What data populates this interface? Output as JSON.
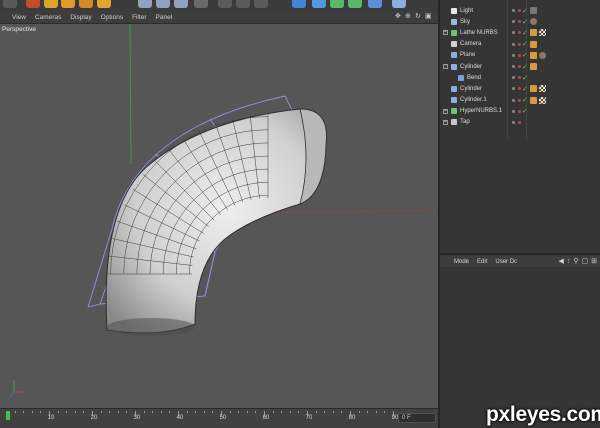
{
  "viewport": {
    "menu": [
      "View",
      "Cameras",
      "Display",
      "Options",
      "Filter",
      "Panel"
    ],
    "label": "Perspective"
  },
  "toolbar": {
    "icons": [
      {
        "name": "undo-icon",
        "color": "#5a5a5a"
      },
      {
        "name": "live-selection-icon",
        "color": "#c24a2d"
      },
      {
        "name": "move-icon",
        "color": "#e0a22a"
      },
      {
        "name": "scale-icon",
        "color": "#e09a2a"
      },
      {
        "name": "rotate-icon",
        "color": "#d48a22"
      },
      {
        "name": "last-tool-icon",
        "color": "#e2a530"
      },
      {
        "name": "x-axis-icon",
        "color": "#8fa2c0"
      },
      {
        "name": "y-axis-icon",
        "color": "#8fa2c0"
      },
      {
        "name": "z-axis-icon",
        "color": "#8fa2c0"
      },
      {
        "name": "coordinate-system-icon",
        "color": "#6a6a6a"
      },
      {
        "name": "render-view-icon",
        "color": "#5a5a5a"
      },
      {
        "name": "render-picture-viewer-icon",
        "color": "#5a5a5a"
      },
      {
        "name": "render-settings-icon",
        "color": "#5a5a5a"
      },
      {
        "name": "cube-icon",
        "color": "#3f86d4"
      },
      {
        "name": "pen-icon",
        "color": "#4f9bd8"
      },
      {
        "name": "subdivision-icon",
        "color": "#58b86a"
      },
      {
        "name": "array-icon",
        "color": "#5ab66c"
      },
      {
        "name": "deformer-icon",
        "color": "#5b8fd8"
      },
      {
        "name": "scene-icon",
        "color": "#8ab0e0"
      }
    ]
  },
  "objects": [
    {
      "name": "Light",
      "icon": "light-icon",
      "icon_color": "#e8e8e8",
      "indent": 0,
      "expand": "",
      "check": "✓",
      "tags": [
        "sky"
      ]
    },
    {
      "name": "Sky",
      "icon": "sky-icon",
      "icon_color": "#9fb9d8",
      "indent": 0,
      "expand": "",
      "check": "✓",
      "tags": [
        "globe"
      ]
    },
    {
      "name": "Lathe NURBS",
      "icon": "lathe-nurbs-icon",
      "icon_color": "#6fc26f",
      "indent": 0,
      "expand": "+",
      "check": "✓",
      "tags": [
        "orange",
        "checker"
      ]
    },
    {
      "name": "Camera",
      "icon": "camera-icon",
      "icon_color": "#d0d0d0",
      "indent": 0,
      "expand": "",
      "check": "✓",
      "tags": [
        "orange"
      ]
    },
    {
      "name": "Plane",
      "icon": "plane-icon",
      "icon_color": "#8ab0e0",
      "indent": 0,
      "expand": "",
      "check": "✓",
      "tags": [
        "orange",
        "globe"
      ]
    },
    {
      "name": "Cylinder",
      "icon": "cylinder-icon",
      "icon_color": "#8ab0e0",
      "indent": 0,
      "expand": "-",
      "check": "✓",
      "tags": [
        "orange"
      ]
    },
    {
      "name": "Bend",
      "icon": "bend-icon",
      "icon_color": "#7aa0e0",
      "indent": 1,
      "expand": "",
      "check": "✓",
      "tags": []
    },
    {
      "name": "Cylinder",
      "icon": "cylinder-icon",
      "icon_color": "#8ab0e0",
      "indent": 0,
      "expand": "",
      "check": "✓",
      "tags": [
        "orange",
        "checker"
      ]
    },
    {
      "name": "Cylinder.1",
      "icon": "cylinder-icon",
      "icon_color": "#8ab0e0",
      "indent": 0,
      "expand": "",
      "check": "✓",
      "tags": [
        "orange",
        "checker"
      ]
    },
    {
      "name": "HyperNURBS.1",
      "icon": "hypernurbs-icon",
      "icon_color": "#6fc26f",
      "indent": 0,
      "expand": "+",
      "check": "✓",
      "tags": []
    },
    {
      "name": "Tap",
      "icon": "null-icon",
      "icon_color": "#c8c8c8",
      "indent": 0,
      "expand": "+",
      "check": "",
      "tags": []
    }
  ],
  "attributes": {
    "menu": [
      "Mode",
      "Edit",
      "User Dc"
    ]
  },
  "timeline": {
    "ticks": [
      "0",
      "10",
      "20",
      "30",
      "40",
      "50",
      "60",
      "70",
      "80",
      "90"
    ],
    "current_frame": "0 F"
  },
  "watermark": "pxleyes.com"
}
